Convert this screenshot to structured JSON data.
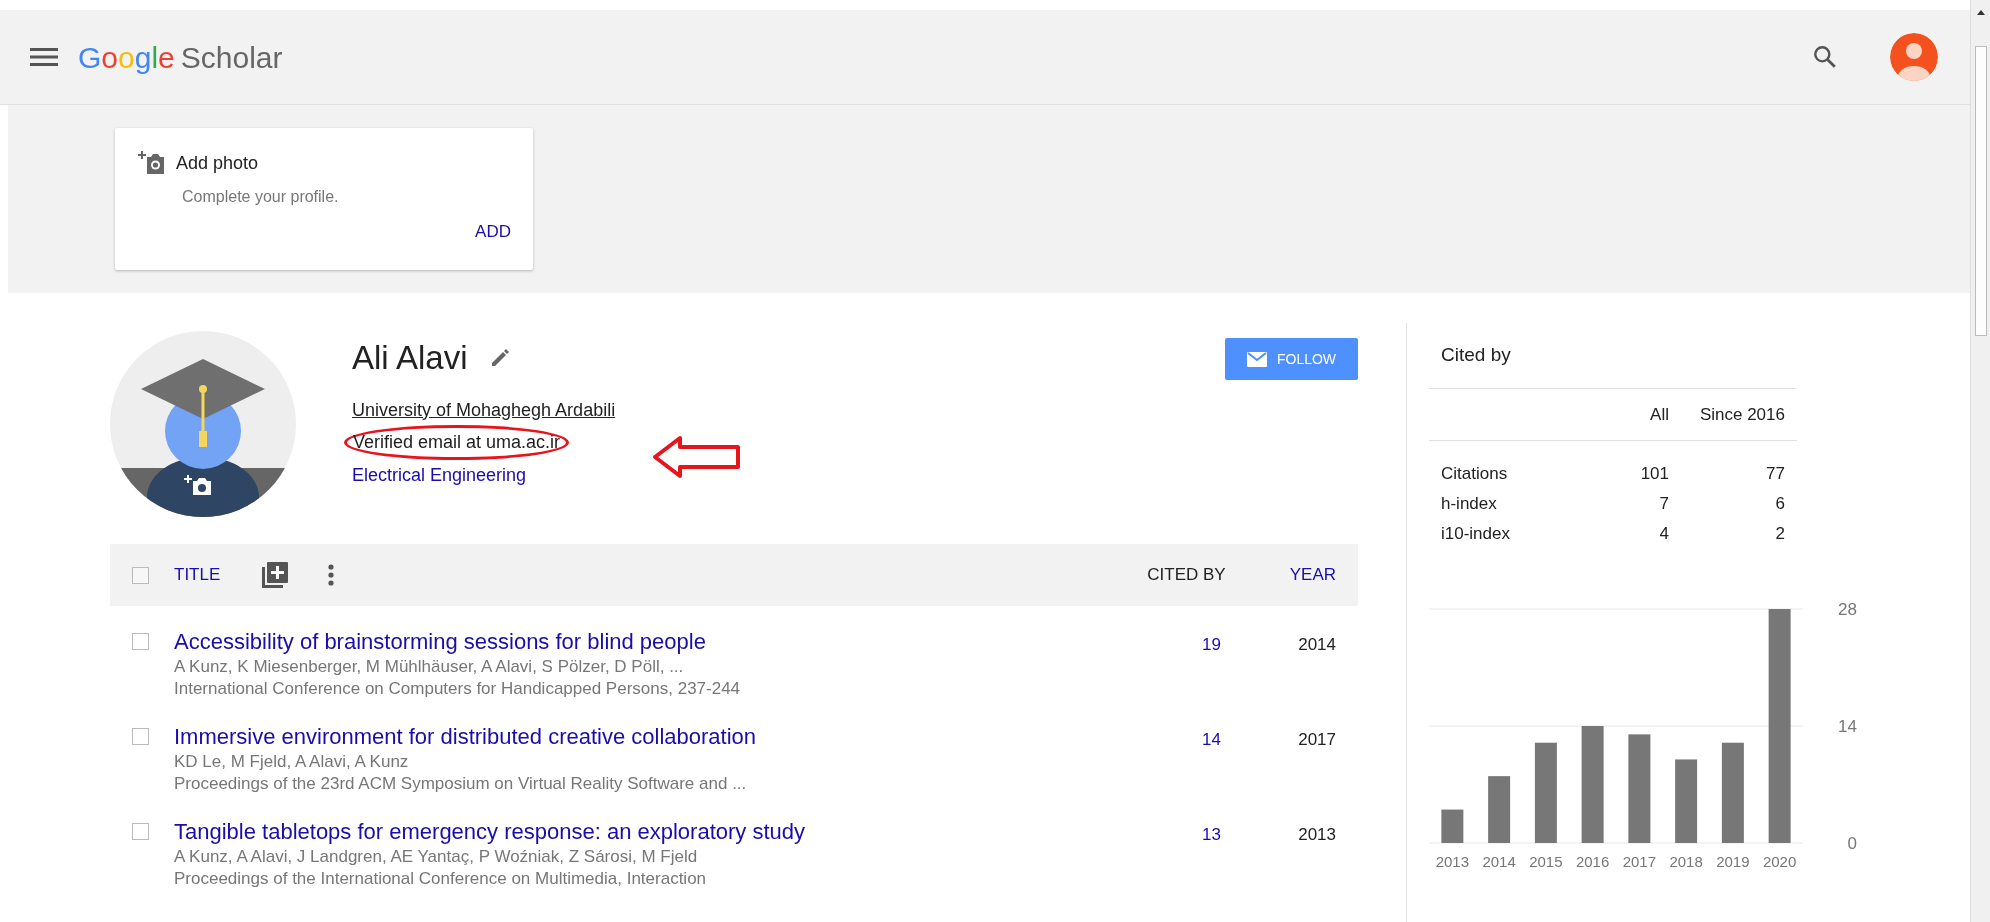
{
  "header": {
    "brand_first": "Google",
    "brand_second": "Scholar"
  },
  "add_photo_card": {
    "title": "Add photo",
    "subtitle": "Complete your profile.",
    "action": "ADD"
  },
  "profile": {
    "name": "Ali Alavi",
    "affiliation": "University of Mohaghegh Ardabili",
    "email": "Verified email at uma.ac.ir",
    "interests": [
      "Electrical Engineering"
    ],
    "follow_button": "FOLLOW"
  },
  "table": {
    "select_all_checked": false,
    "columns": [
      {
        "label": "TITLE",
        "sorted": false
      },
      {
        "label": "CITED BY",
        "sorted": true
      },
      {
        "label": "YEAR",
        "sorted": false
      }
    ],
    "rows": [
      {
        "checked": false,
        "title": "Accessibility of brainstorming sessions for blind people",
        "authors": "A Kunz, K Miesenberger, M Mühlhäuser, A Alavi, S Pölzer, D Pöll, ...",
        "venue": "International Conference on Computers for Handicapped Persons, 237-244",
        "cited_by": "19",
        "year": "2014"
      },
      {
        "checked": false,
        "title": "Immersive environment for distributed creative collaboration",
        "authors": "KD Le, M Fjeld, A Alavi, A Kunz",
        "venue": "Proceedings of the 23rd ACM Symposium on Virtual Reality Software and ...",
        "cited_by": "14",
        "year": "2017"
      },
      {
        "checked": false,
        "title": "Tangible tabletops for emergency response: an exploratory study",
        "authors": "A Kunz, A Alavi, J Landgren, AE Yantaç, P Woźniak, Z Sárosi, M Fjeld",
        "venue": "Proceedings of the International Conference on Multimedia, Interaction",
        "cited_by": "13",
        "year": "2013"
      }
    ]
  },
  "cited_by": {
    "title": "Cited by",
    "columns": [
      "All",
      "Since 2016"
    ],
    "rows": [
      {
        "label": "Citations",
        "all": "101",
        "since": "77"
      },
      {
        "label": "h-index",
        "all": "7",
        "since": "6"
      },
      {
        "label": "i10-index",
        "all": "4",
        "since": "2"
      }
    ],
    "chart_data": {
      "type": "bar",
      "categories": [
        "2013",
        "2014",
        "2015",
        "2016",
        "2017",
        "2018",
        "2019",
        "2020"
      ],
      "values": [
        4,
        8,
        12,
        14,
        13,
        10,
        12,
        28
      ],
      "ylim": [
        0,
        28
      ],
      "yticks": [
        0,
        14,
        28
      ]
    }
  }
}
